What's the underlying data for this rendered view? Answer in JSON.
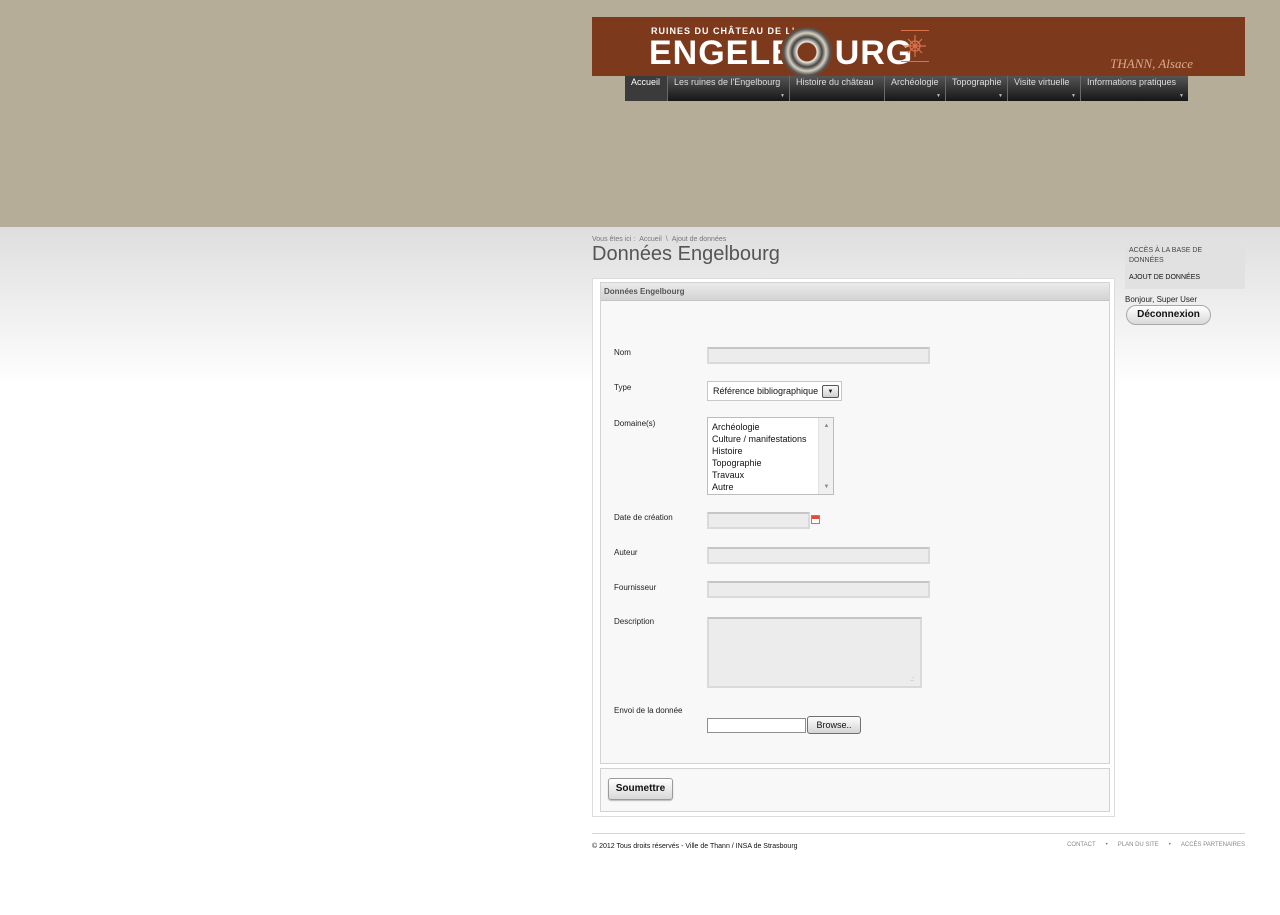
{
  "banner": {
    "small_title": "RUINES DU CHÂTEAU DE L'",
    "big_title": "ENGELB",
    "big_title_end": "URG",
    "city": "THANN, Alsace"
  },
  "menu": {
    "items": [
      {
        "label": "Accueil",
        "has_sub": false
      },
      {
        "label": "Les ruines de l'Engelbourg",
        "has_sub": true
      },
      {
        "label": "Histoire du château",
        "has_sub": false
      },
      {
        "label": "Archéologie",
        "has_sub": true
      },
      {
        "label": "Topographie",
        "has_sub": true
      },
      {
        "label": "Visite virtuelle",
        "has_sub": true
      },
      {
        "label": "Informations pratiques",
        "has_sub": true
      }
    ],
    "arrow": "▼"
  },
  "breadcrumb": {
    "prefix": "Vous êtes ici :",
    "home": "Accueil",
    "sep": "\\",
    "current": "Ajout de données"
  },
  "page": {
    "title": "Données Engelbourg"
  },
  "form": {
    "legend": "Données Engelbourg",
    "labels": {
      "nom": "Nom",
      "type": "Type",
      "domaines": "Domaine(s)",
      "date": "Date de création",
      "auteur": "Auteur",
      "fournisseur": "Fournisseur",
      "description": "Description",
      "envoi": "Envoi de la donnée"
    },
    "type_value": "Référence bibliographique",
    "domaines_options": [
      "Archéologie",
      "Culture / manifestations",
      "Histoire",
      "Topographie",
      "Travaux",
      "Autre"
    ],
    "browse_label": "Browse..",
    "submit_label": "Soumettre"
  },
  "sidebar": {
    "item1": "ACCÈS À LA BASE DE DONNÉES",
    "item2": "AJOUT DE DONNÉES",
    "greeting": "Bonjour, Super User",
    "logout_label": "Déconnexion"
  },
  "footer": {
    "copyright": "© 2012 Tous droits réservés - Ville de Thann / INSA de Strasbourg",
    "links": [
      "CONTACT",
      "PLAN DU SITE",
      "ACCÈS PARTENAIRES"
    ],
    "sep": "•"
  },
  "colors": {
    "banner": "#7d391b",
    "top_bg": "#b6ad99"
  }
}
